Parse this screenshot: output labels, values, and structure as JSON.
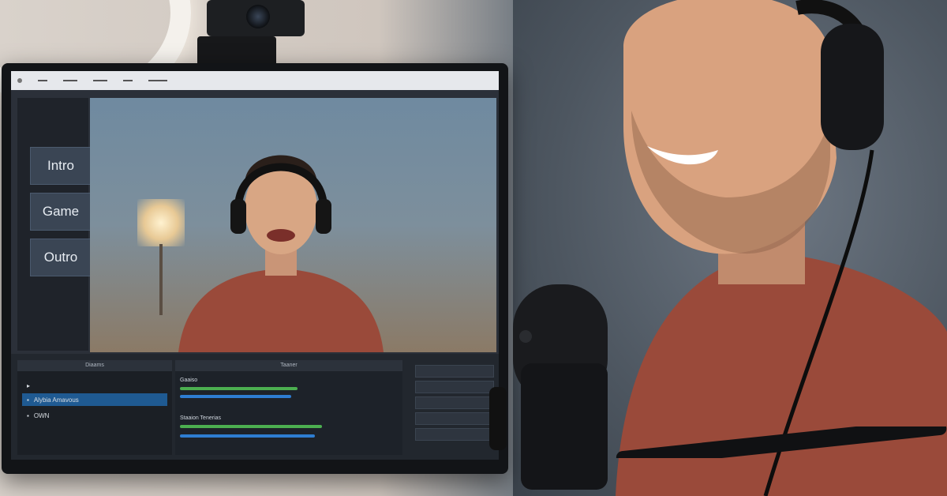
{
  "monitor": {
    "scenes": [
      {
        "label": "Intro"
      },
      {
        "label": "Game"
      },
      {
        "label": "Outro"
      }
    ],
    "sources": {
      "title": "Diaams",
      "items": [
        {
          "label": "Alybia Amavous"
        },
        {
          "label": "OWN"
        }
      ]
    },
    "mixer": {
      "title": "Taaner",
      "tracks": [
        {
          "label": "Gaaiso",
          "level": 0.62
        },
        {
          "label": "Staaion Tenerias",
          "level": 0.75
        }
      ]
    }
  },
  "colors": {
    "accent_blue": "#1f5a92",
    "meter_green": "#4caf50",
    "meter_red": "#d64b3c",
    "shirt": "#9a4a3a"
  }
}
